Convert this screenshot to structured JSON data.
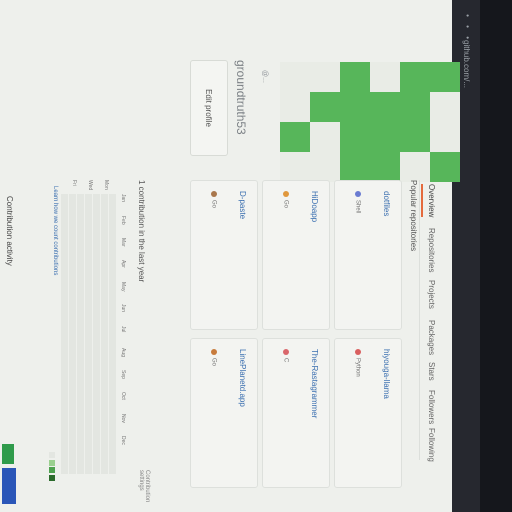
{
  "window": {
    "title": "github.com/..."
  },
  "profile": {
    "name": "groundtruth53",
    "handle": "@...",
    "edit_label": "Edit profile"
  },
  "tabs": [
    {
      "label": "Overview",
      "active": true
    },
    {
      "label": "Repositories"
    },
    {
      "label": "Projects"
    },
    {
      "label": "Packages"
    },
    {
      "label": "Stars"
    },
    {
      "label": "Followers"
    },
    {
      "label": "Following"
    }
  ],
  "popular": {
    "title": "Popular repositories"
  },
  "repos": [
    {
      "name": "dotfiles",
      "lang": "Shell",
      "color": "#6a7bd1"
    },
    {
      "name": "hiyouga-llama",
      "lang": "Python",
      "color": "#d95f5f"
    },
    {
      "name": "HiDoapp",
      "lang": "Go",
      "color": "#e0983d"
    },
    {
      "name": "The-Rastagrammer",
      "lang": "C",
      "color": "#d9666b"
    },
    {
      "name": "D-paste",
      "lang": "Go",
      "color": "#a9774c"
    },
    {
      "name": "LinePlanetd.app",
      "lang": "Go",
      "color": "#c77b3c"
    }
  ],
  "contributions": {
    "title": "1 contribution in the last year",
    "settings": "Contribution settings",
    "learn": "Learn how we count contributions",
    "months": [
      "Jan",
      "Feb",
      "Mar",
      "Apr",
      "May",
      "Jun",
      "Jul",
      "Aug",
      "Sep",
      "Oct",
      "Nov",
      "Dec"
    ],
    "days": [
      "Mon",
      "Wed",
      "Fri"
    ]
  },
  "overview_heading": "Contribution activity",
  "colors": {
    "identicon": "#57b65a",
    "accent": "#e46a3d"
  }
}
